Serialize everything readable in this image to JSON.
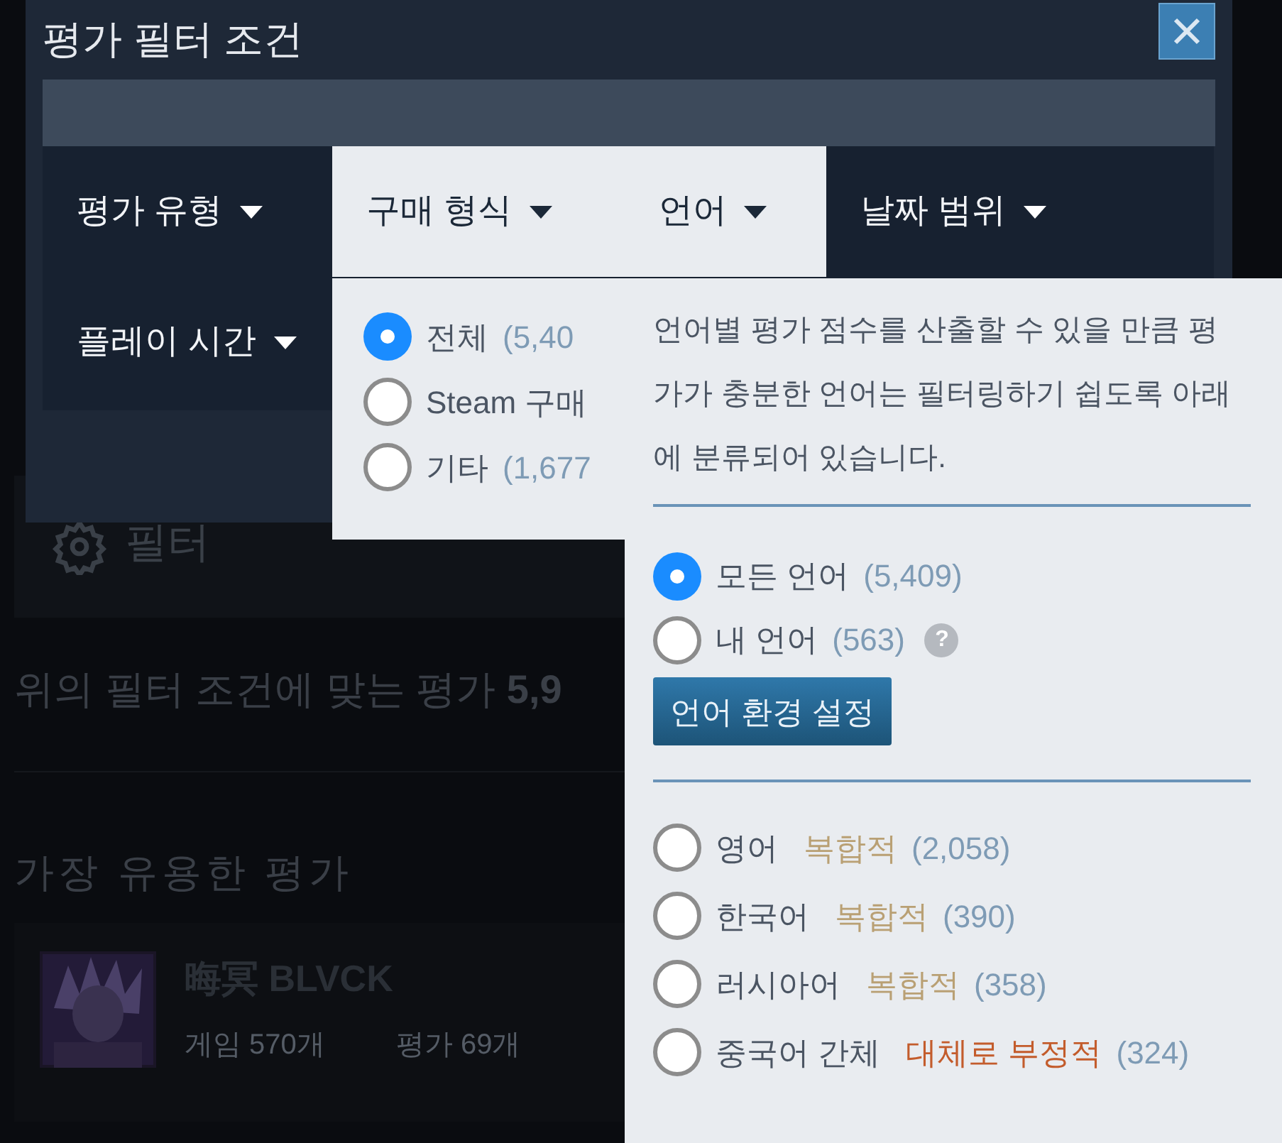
{
  "background": {
    "filter_label": "필터",
    "result_text": "위의 필터 조건에 맞는 평가 **5,9**",
    "section_title": "가장 유용한 평가",
    "review": {
      "author": "晦冥 BLVCK",
      "games": "게임 570개",
      "reviews": "평가 69개"
    }
  },
  "dialog": {
    "title": "평가 필터 조건",
    "tabs": [
      {
        "label": "평가 유형",
        "selected": false
      },
      {
        "label": "구매 형식",
        "selected": true
      },
      {
        "label": "언어",
        "selected": true
      },
      {
        "label": "날짜 범위",
        "selected": false
      },
      {
        "label": "플레이 시간",
        "selected": false
      }
    ]
  },
  "purchase_menu": {
    "options": [
      {
        "label": "전체",
        "count": "(5,40",
        "selected": true
      },
      {
        "label": "Steam 구매",
        "selected": false
      },
      {
        "label": "기타",
        "count": "(1,677",
        "selected": false
      }
    ]
  },
  "language_menu": {
    "note": "언어별 평가 점수를 산출할 수 있을 만큼 평가가 충분한 언어는 필터링하기 쉽도록 아래에 분류되어 있습니다.",
    "options": [
      {
        "label": "모든 언어",
        "count": "(5,409)",
        "selected": true
      },
      {
        "label": "내 언어",
        "count": "(563)",
        "selected": false,
        "help": "?"
      }
    ],
    "settings_button": "언어 환경 설정",
    "languages": [
      {
        "label": "영어",
        "rating": "복합적",
        "color": "#b9a074",
        "count": "(2,058)",
        "selected": false
      },
      {
        "label": "한국어",
        "rating": "복합적",
        "color": "#b9a074",
        "count": "(390)",
        "selected": false
      },
      {
        "label": "러시아어",
        "rating": "복합적",
        "color": "#b9a074",
        "count": "(358)",
        "selected": false
      },
      {
        "label": "중국어 간체",
        "rating": "대체로 부정적",
        "color": "#c35c2c",
        "count": "(324)",
        "selected": false
      }
    ]
  }
}
